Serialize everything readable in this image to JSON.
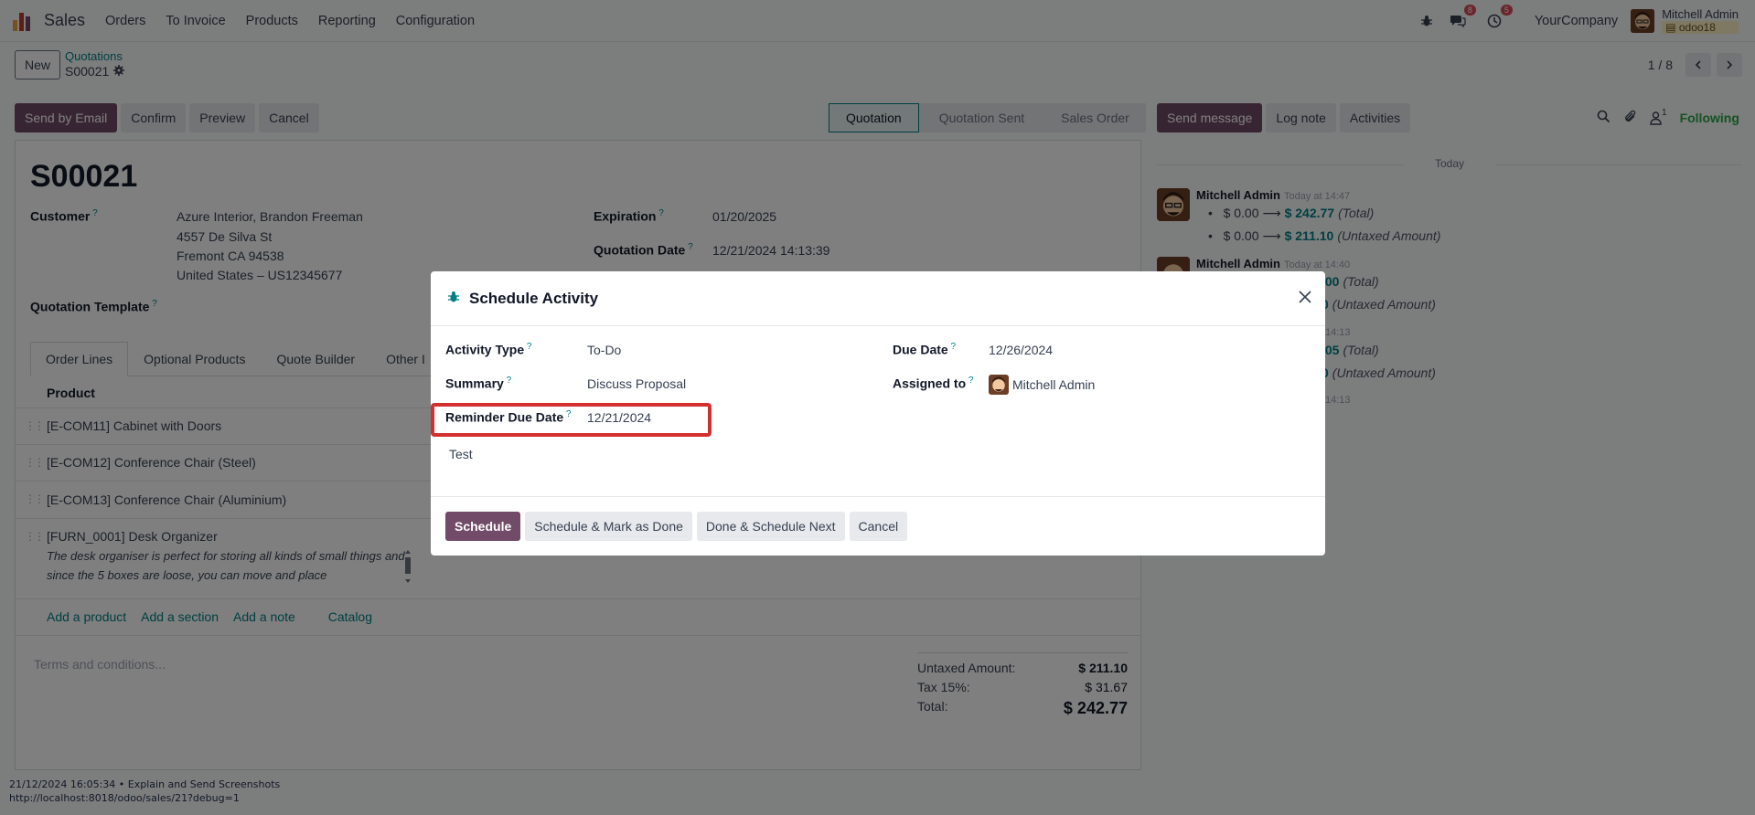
{
  "navbar": {
    "app_name": "Sales",
    "menu": [
      "Orders",
      "To Invoice",
      "Products",
      "Reporting",
      "Configuration"
    ],
    "messages_badge": "8",
    "activities_badge": "5",
    "company": "YourCompany",
    "user_name": "Mitchell Admin",
    "db_name": "odoo18"
  },
  "control": {
    "new_label": "New",
    "breadcrumb_parent": "Quotations",
    "breadcrumb_current": "S00021",
    "pager_value": "1 / 8"
  },
  "actions": {
    "send_by_email": "Send by Email",
    "confirm": "Confirm",
    "preview": "Preview",
    "cancel": "Cancel"
  },
  "status_stages": [
    "Quotation",
    "Quotation Sent",
    "Sales Order"
  ],
  "form": {
    "title": "S00021",
    "customer_label": "Customer",
    "customer_lines": [
      "Azure Interior, Brandon Freeman",
      "4557 De Silva St",
      "Fremont CA 94538",
      "United States – US12345677"
    ],
    "expiration_label": "Expiration",
    "expiration_value": "01/20/2025",
    "quotation_date_label": "Quotation Date",
    "quotation_date_value": "12/21/2024 14:13:39",
    "template_label": "Quotation Template",
    "tabs": [
      "Order Lines",
      "Optional Products",
      "Quote Builder",
      "Other I"
    ],
    "product_header": "Product",
    "lines": [
      {
        "name": "[E-COM11] Cabinet with Doors"
      },
      {
        "name": "[E-COM12] Conference Chair (Steel)"
      },
      {
        "name": "[E-COM13] Conference Chair (Aluminium)"
      },
      {
        "name": "[FURN_0001] Desk Organizer",
        "desc": "The desk organiser is perfect for storing all kinds of small things and since the 5 boxes are loose, you can move and place"
      }
    ],
    "add_product": "Add a product",
    "add_section": "Add a section",
    "add_note": "Add a note",
    "catalog": "Catalog",
    "terms_placeholder": "Terms and conditions...",
    "untaxed_label": "Untaxed Amount:",
    "untaxed_value": "$ 211.10",
    "tax_label": "Tax 15%:",
    "tax_value": "$ 31.67",
    "total_label": "Total:",
    "total_value": "$ 242.77"
  },
  "chatter": {
    "send_message": "Send message",
    "log_note": "Log note",
    "activities": "Activities",
    "followers_count": "1",
    "following": "Following",
    "today": "Today",
    "messages": [
      {
        "author": "Mitchell Admin",
        "time": "Today at 14:47",
        "tracks": [
          {
            "old": "$ 0.00",
            "new": "$ 242.77",
            "field": "(Total)"
          },
          {
            "old": "$ 0.00",
            "new": "$ 211.10",
            "field": "(Untaxed Amount)"
          }
        ]
      },
      {
        "author": "Mitchell Admin",
        "time": "Today at 14:40",
        "tracks": [
          {
            "new_partial": ".00",
            "field": "(Total)"
          },
          {
            "new_partial": "0",
            "field": "(Untaxed Amount)"
          }
        ]
      },
      {
        "time_partial": "14:13",
        "tracks": [
          {
            "new_partial": ".05",
            "field": "(Total)"
          },
          {
            "new_partial": "0",
            "field": "(Untaxed Amount)"
          }
        ]
      },
      {
        "time_partial": "14:13"
      }
    ]
  },
  "modal": {
    "title": "Schedule Activity",
    "activity_type_label": "Activity Type",
    "activity_type_value": "To-Do",
    "summary_label": "Summary",
    "summary_value": "Discuss Proposal",
    "reminder_label": "Reminder Due Date",
    "reminder_value": "12/21/2024",
    "note": "Test",
    "due_date_label": "Due Date",
    "due_date_value": "12/26/2024",
    "assigned_label": "Assigned to",
    "assigned_value": "Mitchell Admin",
    "btn_schedule": "Schedule",
    "btn_schedule_done": "Schedule & Mark as Done",
    "btn_done_next": "Done & Schedule Next",
    "btn_cancel": "Cancel"
  },
  "footer": {
    "line1": "21/12/2024 16:05:34 • Explain and Send Screenshots",
    "line2": "http://localhost:8018/odoo/sales/21?debug=1"
  },
  "colors": {
    "primary": "#714b67",
    "accent": "#017e84",
    "highlight": "#d32f2f",
    "following": "#28a745"
  }
}
